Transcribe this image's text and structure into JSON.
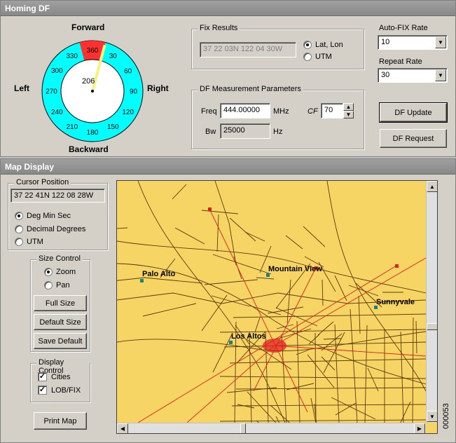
{
  "homing": {
    "title": "Homing DF",
    "compass": {
      "forward": "Forward",
      "backward": "Backward",
      "left": "Left",
      "right": "Right",
      "current": "206",
      "labels": [
        "360",
        "30",
        "60",
        "90",
        "120",
        "150",
        "180",
        "210",
        "240",
        "270",
        "300",
        "330"
      ],
      "highlight_color": "#ff3030",
      "ring_color": "#00ffff",
      "needle_color": "#f4f480"
    },
    "fix_results": {
      "label": "Fix Results",
      "value": "37 22 03N 122 04 30W",
      "opt_latlon": "Lat, Lon",
      "opt_utm": "UTM"
    },
    "auto_fix": {
      "label": "Auto-FIX Rate",
      "value": "10"
    },
    "repeat": {
      "label": "Repeat Rate",
      "value": "30"
    },
    "params": {
      "label": "DF Measurement Parameters",
      "freq_label": "Freq",
      "freq_value": "444.00000",
      "freq_unit": "MHz",
      "cf_label": "CF",
      "cf_value": "70",
      "bw_label": "Bw",
      "bw_value": "25000",
      "bw_unit": "Hz"
    },
    "df_update": "DF Update",
    "df_request": "DF Request"
  },
  "map": {
    "title": "Map Display",
    "cursor": {
      "label": "Cursor Position",
      "value": "37 22 41N 122 08 28W",
      "opt_dms": "Deg Min Sec",
      "opt_dd": "Decimal Degrees",
      "opt_utm": "UTM"
    },
    "size": {
      "label": "Size Control",
      "opt_zoom": "Zoom",
      "opt_pan": "Pan",
      "full": "Full Size",
      "default": "Default Size",
      "save": "Save Default"
    },
    "display": {
      "label": "Display Control",
      "cities": "Cities",
      "lob": "LOB/FIX"
    },
    "print": "Print Map",
    "cities": {
      "palo_alto": "Palo Alto",
      "mountain_view": "Mountain View",
      "sunnyvale": "Sunnyvale",
      "los_altos": "Los Altos"
    },
    "land_color": "#f7d564",
    "lob_color": "#e02020"
  },
  "figure_id": "000053"
}
